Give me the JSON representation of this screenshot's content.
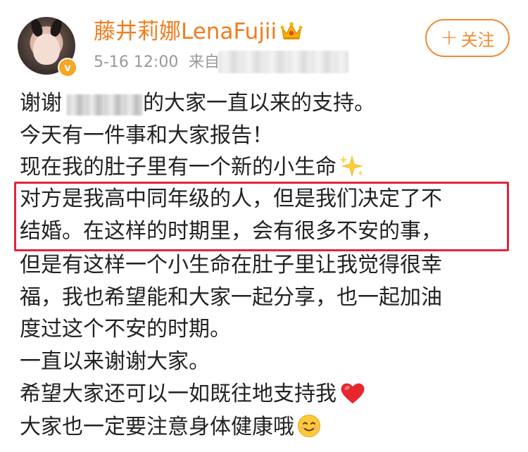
{
  "post": {
    "author": {
      "name": "藤井莉娜LenaFujii",
      "verified_mark": "v"
    },
    "meta": {
      "time": "5-16 12:00",
      "source_prefix": "来自"
    },
    "follow_button": {
      "plus": "+",
      "label": "关注"
    },
    "body": {
      "line1_prefix": "谢谢",
      "line1_suffix": "的大家一直以来的支持。",
      "line2": "今天有一件事和大家报告！",
      "line3": "现在我的肚子里有一个新的小生命",
      "line4": "对方是我高中同年级的人，但是我们决定了不",
      "line5": "结婚。在这样的时期里，会有很多不安的事，",
      "line6": "但是有这样一个小生命在肚子里让我觉得很幸",
      "line7": "福，我也希望能和大家一起分享，也一起加油",
      "line8": "度过这个不安的时期。",
      "line9": "一直以来谢谢大家。",
      "line10": "希望大家还可以一如既往地支持我",
      "line11": "大家也一定要注意身体健康哦"
    }
  },
  "colors": {
    "username": "#f07d1e",
    "follow_border": "#f08a34",
    "highlight_border": "#e0263a",
    "meta_text": "#999999",
    "body_text": "#222222"
  },
  "icons": {
    "crown": "crown-icon",
    "sparkles": "sparkles-icon",
    "heart": "heart-icon",
    "smile": "smile-icon"
  }
}
